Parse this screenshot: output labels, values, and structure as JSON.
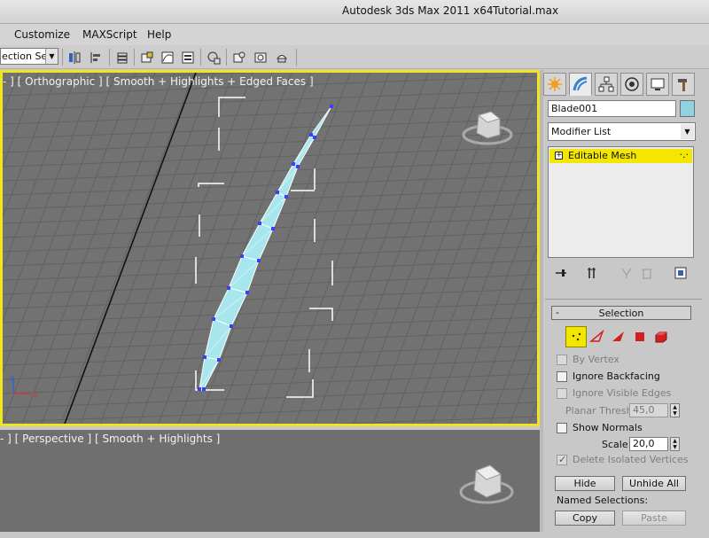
{
  "window": {
    "app_title": "Autodesk 3ds Max  2011 x64",
    "file_name": "Tutorial.max"
  },
  "menu": [
    "Customize",
    "MAXScript",
    "Help"
  ],
  "toolbar": {
    "named_selection_text": "lection Se",
    "icons": [
      "mirror-icon",
      "align-icon",
      "layers-icon",
      "graphite-icon",
      "curve-editor-icon",
      "schematic-view-icon",
      "material-editor-icon",
      "render-setup-icon",
      "rendered-frame-icon",
      "render-icon"
    ]
  },
  "viewports": {
    "top_label": "- ] [ Orthographic ] [ Smooth + Highlights + Edged Faces ]",
    "bottom_label": "- ] [ Perspective ] [ Smooth + Highlights ]",
    "axis_x": "x",
    "axis_z": "z"
  },
  "command_panel": {
    "tabs": [
      "create-tab",
      "modify-tab",
      "hierarchy-tab",
      "motion-tab",
      "display-tab",
      "utilities-tab"
    ],
    "object_name": "Blade001",
    "object_color": "#8fd3e2",
    "modifier_list": "Modifier List",
    "stack_items": [
      "Editable Mesh"
    ],
    "selection": {
      "title": "Selection",
      "collapse": "-",
      "by_vertex": "By Vertex",
      "ignore_backfacing": "Ignore Backfacing",
      "ignore_visible_edges": "Ignore Visible Edges",
      "planar_thresh_label": "Planar Thresh:",
      "planar_thresh_value": "45,0",
      "show_normals": "Show Normals",
      "scale_label": "Scale:",
      "scale_value": "20,0",
      "delete_isolated": "Delete Isolated Vertices",
      "hide": "Hide",
      "unhide_all": "Unhide All",
      "named_selections": "Named Selections:",
      "copy": "Copy",
      "paste": "Paste"
    }
  },
  "colors": {
    "active_viewport_border": "#f0e61e",
    "viewport_bg": "#727272",
    "highlight": "#f3e600",
    "mesh": "#a8e6ee",
    "vertex": "#3d3dff"
  }
}
